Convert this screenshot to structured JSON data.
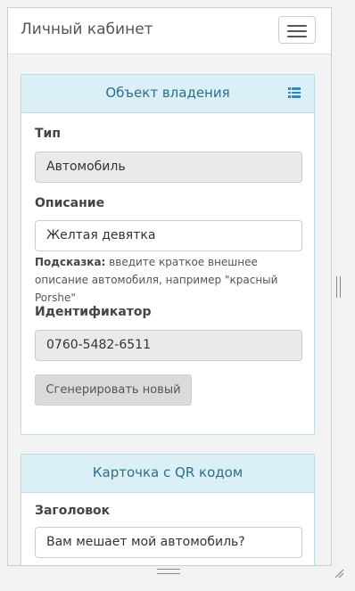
{
  "navbar": {
    "brand": "Личный кабинет",
    "toggle_icon": "hamburger-icon"
  },
  "ownership_panel": {
    "title": "Объект владения",
    "header_icon": "list-icon",
    "type_label": "Тип",
    "type_value": "Автомобиль",
    "description_label": "Описание",
    "description_value": "Желтая девятка",
    "hint_prefix": "Подсказка:",
    "hint_text": " введите краткое внешнее описание автомобиля, например \"красный Porshe\"",
    "identifier_label": "Идентификатор",
    "identifier_value": "0760-5482-6511",
    "generate_button": "Сгенерировать новый"
  },
  "qr_panel": {
    "title": "Карточка с QR кодом",
    "heading_label": "Заголовок",
    "heading_value": "Вам мешает мой автомобиль?"
  }
}
